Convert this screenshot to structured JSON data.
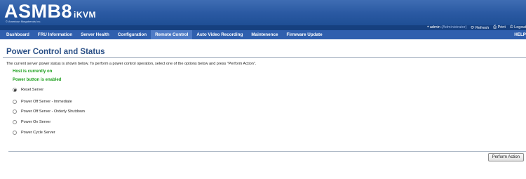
{
  "header": {
    "logo_main": "ASMB8",
    "logo_suffix": "iKVM",
    "logo_subtitle": "© American Megatrends Inc."
  },
  "utility": {
    "user": "admin",
    "role": "(Administrator)",
    "refresh_label": "Refresh",
    "print_label": "Print",
    "logout_label": "Logout"
  },
  "nav": {
    "items": [
      {
        "label": "Dashboard"
      },
      {
        "label": "FRU Information"
      },
      {
        "label": "Server Health"
      },
      {
        "label": "Configuration"
      },
      {
        "label": "Remote Control"
      },
      {
        "label": "Auto Video Recording"
      },
      {
        "label": "Maintenence"
      },
      {
        "label": "Firmware Update"
      }
    ],
    "active_index": 4,
    "help_label": "HELP"
  },
  "page": {
    "title": "Power Control and Status",
    "description": "The current server power status is shown below. To perform a power control operation, select one of the options below and press \"Perform Action\".",
    "host_status": "Host is currently on",
    "power_button_status": "Power button is enabled",
    "options": [
      {
        "label": "Reset Server",
        "checked": true
      },
      {
        "label": "Power Off Server - Immediate",
        "checked": false
      },
      {
        "label": "Power Off Server - Orderly Shutdown",
        "checked": false
      },
      {
        "label": "Power On Server",
        "checked": false
      },
      {
        "label": "Power Cycle Server",
        "checked": false
      }
    ],
    "perform_action_label": "Perform Action"
  },
  "colors": {
    "banner": "#2b5aa3",
    "nav": "#2f5fae",
    "nav_active": "#4f7bc6",
    "title": "#2a4f86",
    "status_ok": "#1a9e1a"
  }
}
